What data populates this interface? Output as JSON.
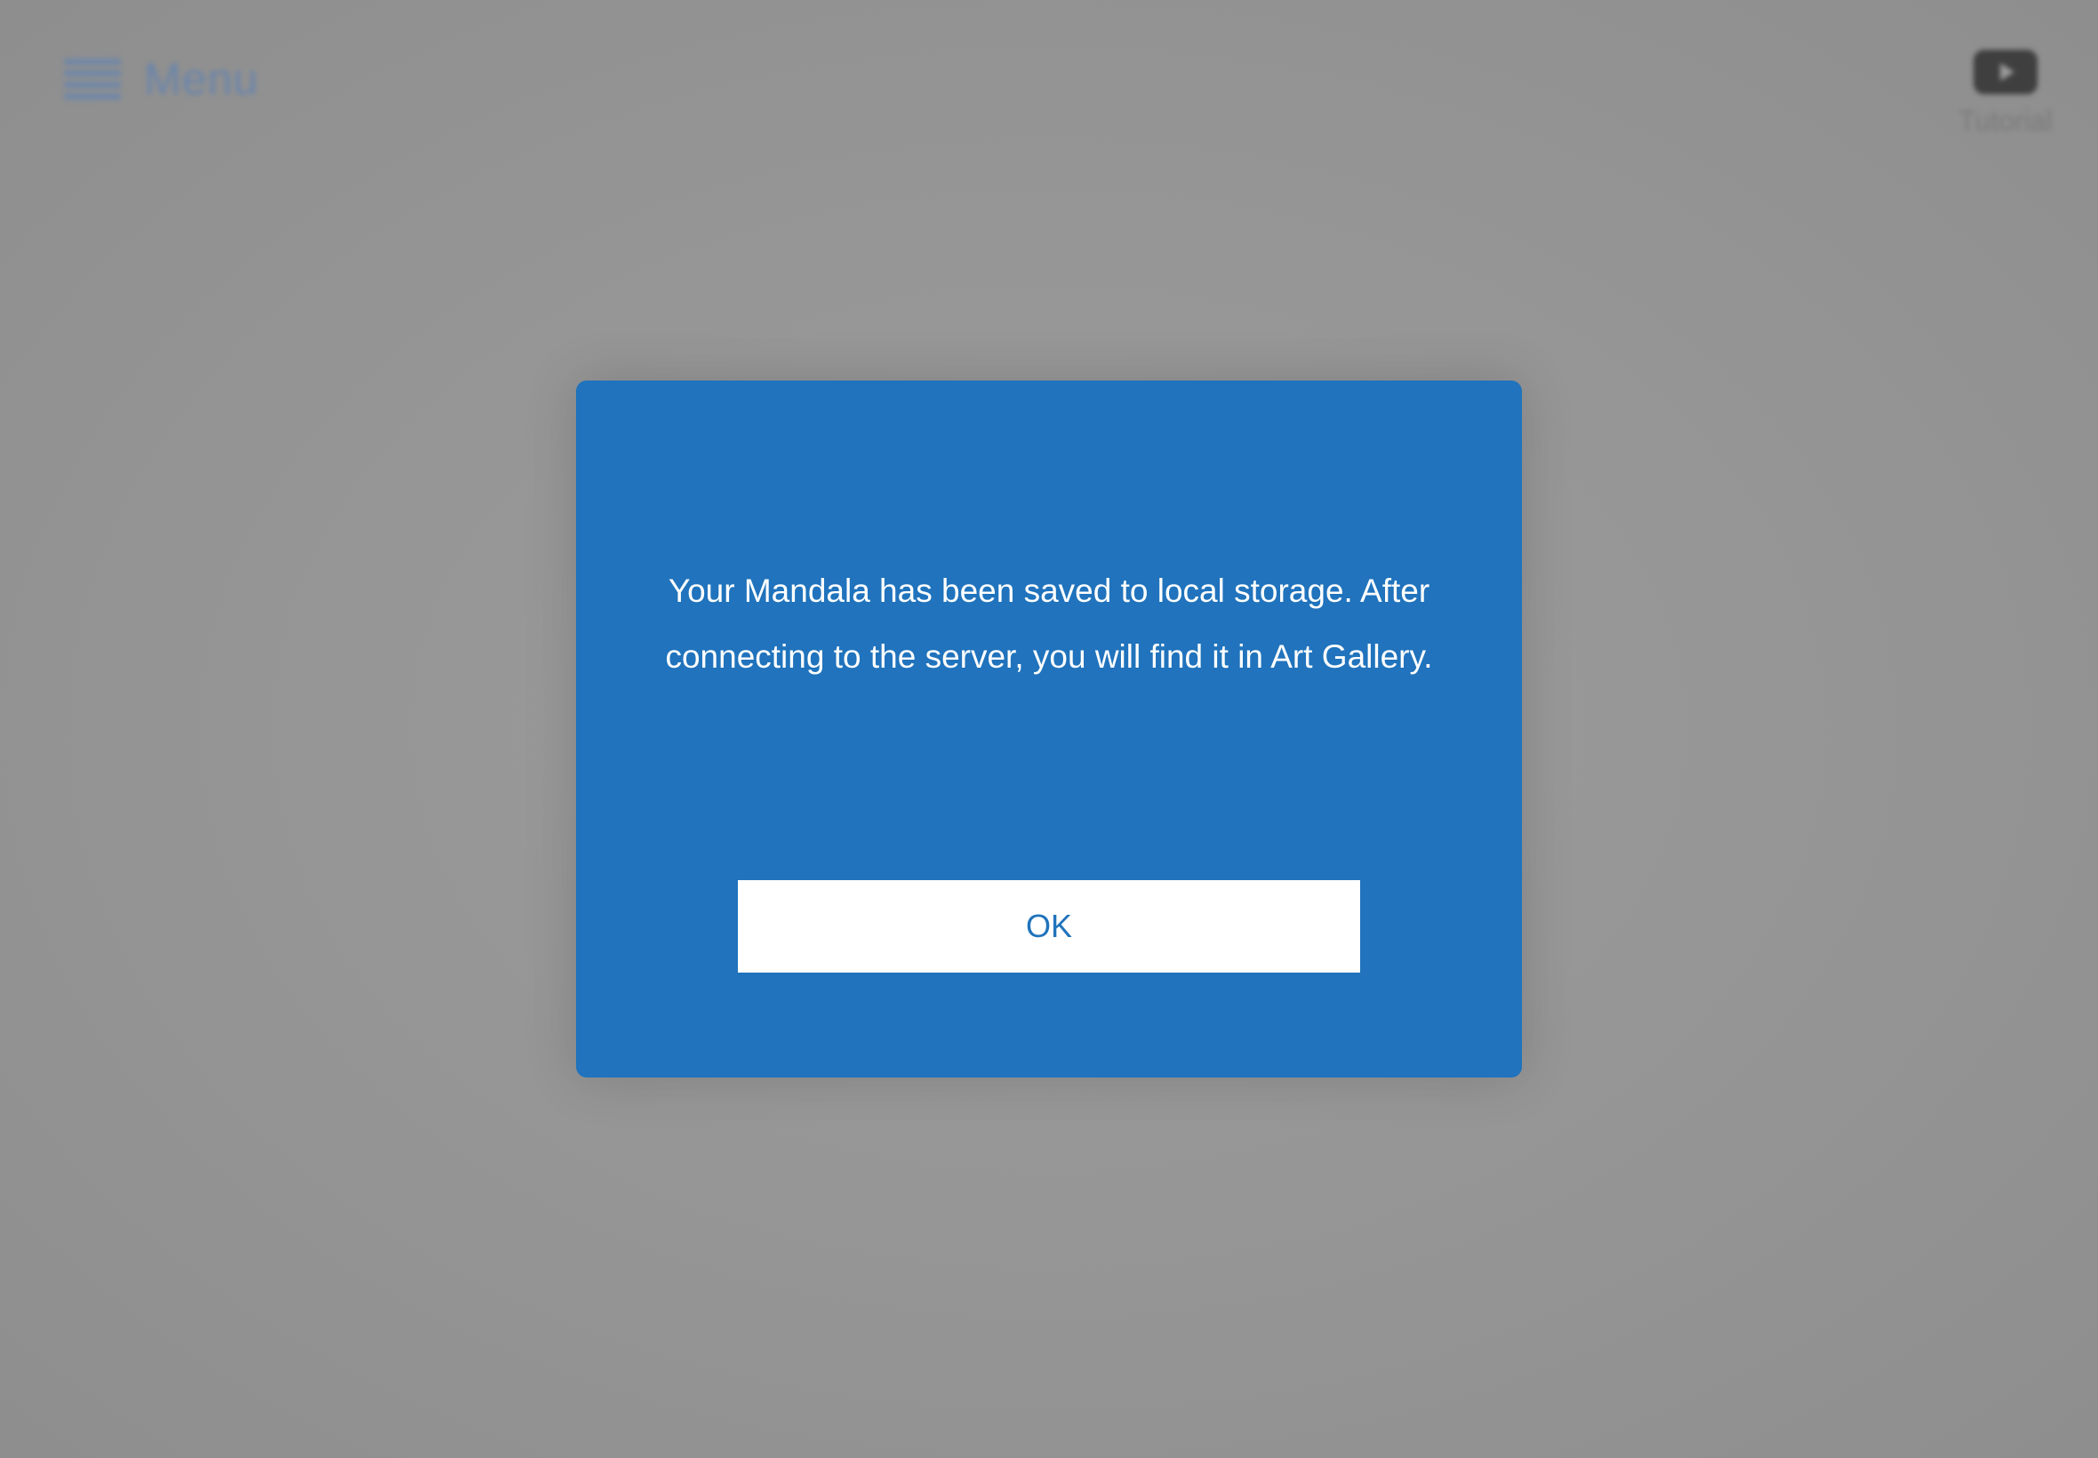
{
  "header": {
    "menu_label": "Menu",
    "menu_icon": "hamburger-icon",
    "tutorial_label": "Tutorial",
    "tutorial_icon": "play-icon"
  },
  "dialog": {
    "message": "Your Mandala has been saved to local storage. After connecting to the server, you will find it in Art Gallery.",
    "ok_label": "OK"
  },
  "colors": {
    "dialog_background": "#2073bc",
    "overlay": "#949494",
    "button_background": "#ffffff",
    "button_text": "#2073bc"
  }
}
